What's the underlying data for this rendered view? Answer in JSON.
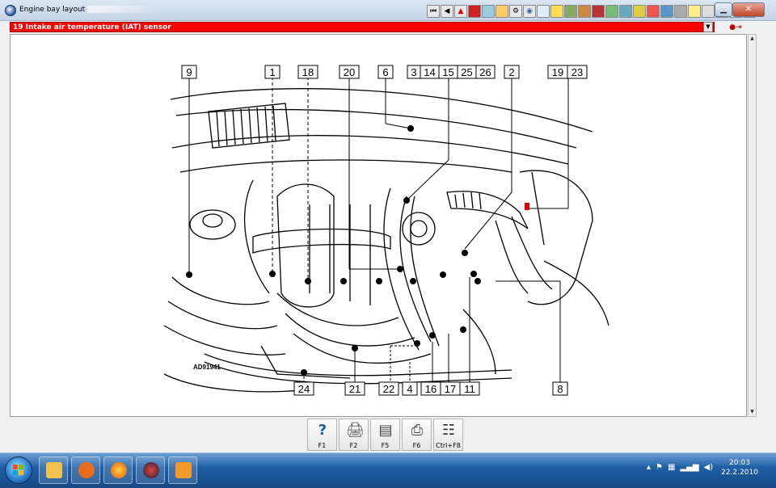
{
  "window": {
    "title": "Engine bay layout"
  },
  "toolbar": {
    "items": [
      "first",
      "prev",
      "warning",
      "red-box",
      "screen",
      "tool",
      "gear",
      "globe",
      "doc",
      "flag",
      "chip",
      "plug",
      "car",
      "grid",
      "chart",
      "bird",
      "stop",
      "monitor",
      "dial",
      "note",
      "key",
      "caution",
      "blank",
      "info"
    ]
  },
  "header": {
    "selected_item": "19  Intake air temperature (IAT) sensor"
  },
  "diagram": {
    "image_code": "AD91941",
    "top_callouts": [
      "9",
      "1",
      "18",
      "20",
      "6",
      "3",
      "14",
      "15",
      "25",
      "26",
      "2",
      "19",
      "23"
    ],
    "bottom_callouts": [
      "24",
      "21",
      "22",
      "4",
      "16",
      "17",
      "11",
      "8"
    ]
  },
  "function_keys": [
    {
      "key": "F1",
      "icon": "help-icon"
    },
    {
      "key": "F2",
      "icon": "print-setup-icon"
    },
    {
      "key": "F5",
      "icon": "document-icon"
    },
    {
      "key": "F6",
      "icon": "printer-icon"
    },
    {
      "key": "Ctrl+F8",
      "icon": "table-icon"
    }
  ],
  "taskbar": {
    "time": "20:03",
    "date": "22.2.2010",
    "tray_icons": [
      "up-arrow-icon",
      "flag-icon",
      "network-icon",
      "signal-icon",
      "volume-icon"
    ]
  },
  "colors": {
    "header_bg": "#ff0000",
    "taskbar": "#1f5fa6",
    "accent": "#c00000"
  }
}
